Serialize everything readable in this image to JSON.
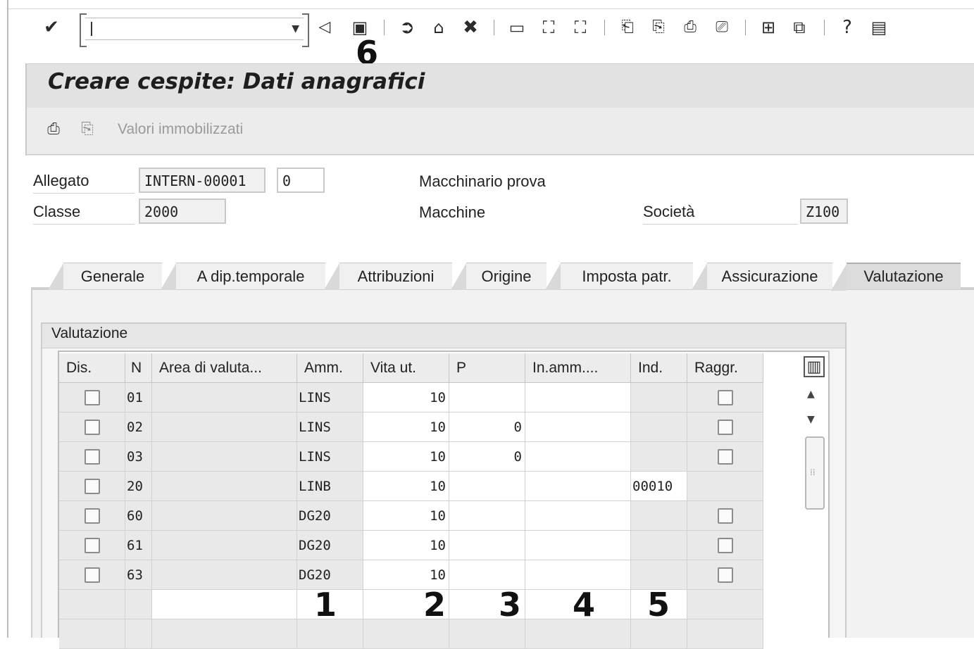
{
  "toolbar": {
    "command_value": "",
    "annotation": "6"
  },
  "title": "Creare cespite:  Dati anagrafici",
  "app_toolbar": {
    "valori_label": "Valori immobilizzati"
  },
  "header": {
    "allegato_label": "Allegato",
    "allegato_value": "INTERN-00001",
    "subnumber_value": "0",
    "allegato_desc": "Macchinario prova",
    "classe_label": "Classe",
    "classe_value": "2000",
    "classe_desc": "Macchine",
    "societa_label": "Società",
    "societa_value": "Z100"
  },
  "tabs": [
    {
      "label": "Generale"
    },
    {
      "label": "A dip.temporale"
    },
    {
      "label": "Attribuzioni"
    },
    {
      "label": "Origine"
    },
    {
      "label": "Imposta patr."
    },
    {
      "label": "Assicurazione"
    },
    {
      "label": "Valutazione"
    }
  ],
  "active_tab": "Valutazione",
  "group_title": "Valutazione",
  "table": {
    "columns": [
      "Dis.",
      "N",
      "Area di valuta...",
      "Amm.",
      "Vita ut.",
      "P",
      "In.amm....",
      "Ind.",
      "Raggr."
    ],
    "rows": [
      {
        "n": "01",
        "amm": "LINS",
        "vita": "10",
        "p": "",
        "ind": "",
        "raggr": true
      },
      {
        "n": "02",
        "amm": "LINS",
        "vita": "10",
        "p": "0",
        "ind": "",
        "raggr": true
      },
      {
        "n": "03",
        "amm": "LINS",
        "vita": "10",
        "p": "0",
        "ind": "",
        "raggr": true
      },
      {
        "n": "20",
        "amm": "LINB",
        "vita": "10",
        "p": "",
        "ind": "00010",
        "raggr": false
      },
      {
        "n": "60",
        "amm": "DG20",
        "vita": "10",
        "p": "",
        "ind": "",
        "raggr": true
      },
      {
        "n": "61",
        "amm": "DG20",
        "vita": "10",
        "p": "",
        "ind": "",
        "raggr": true
      },
      {
        "n": "63",
        "amm": "DG20",
        "vita": "10",
        "p": "",
        "ind": "",
        "raggr": true
      }
    ]
  },
  "annotations": [
    "1",
    "2",
    "3",
    "4",
    "5"
  ],
  "icons": {
    "toolbar": [
      "enter-icon",
      "back-triangle-icon",
      "save-icon",
      "back-icon",
      "exit-icon",
      "cancel-icon",
      "print-icon",
      "find-icon",
      "find-next-icon",
      "first-page-icon",
      "previous-page-icon",
      "next-page-icon",
      "last-page-icon",
      "new-session-icon",
      "shortcut-icon",
      "help-icon",
      "layout-icon"
    ],
    "app": [
      "display-change-icon",
      "asset-values-icon"
    ],
    "table": [
      "column-settings-icon",
      "scroll-up-icon",
      "scroll-down-icon"
    ]
  }
}
